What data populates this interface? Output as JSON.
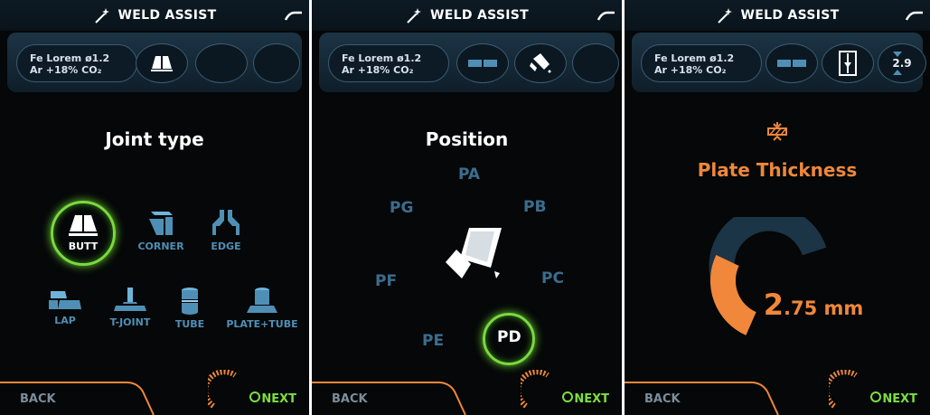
{
  "app_title": "WELD ASSIST",
  "material": {
    "line1": "Fe Lorem ø1.2",
    "line2": "Ar +18% CO₂"
  },
  "screen1": {
    "heading": "Joint type",
    "joints": [
      "BUTT",
      "CORNER",
      "EDGE",
      "LAP",
      "T-JOINT",
      "TUBE",
      "PLATE+TUBE"
    ],
    "selected": "BUTT"
  },
  "screen2": {
    "heading": "Position",
    "positions": [
      "PA",
      "PB",
      "PC",
      "PD",
      "PE",
      "PF",
      "PG"
    ],
    "selected": "PD"
  },
  "screen3": {
    "heading": "Plate Thickness",
    "slot_value": "2.9",
    "value_int": "2",
    "value_rest": ".75 mm"
  },
  "footer": {
    "back": "BACK",
    "next": "NEXT"
  },
  "colors": {
    "accent_green": "#7be03e",
    "orange": "#f0873a",
    "icon_blue": "#4f8fb5",
    "position_blue": "#3b6d8e"
  },
  "icons": [
    "magic-wand-icon",
    "plug-icon",
    "butt-joint-icon",
    "corner-joint-icon",
    "edge-joint-icon",
    "lap-joint-icon",
    "t-joint-icon",
    "tube-icon",
    "plate-tube-icon",
    "torch-position-icon",
    "thickness-icon",
    "arrow-up-icon",
    "arrow-down-icon",
    "next-knob-icon"
  ]
}
